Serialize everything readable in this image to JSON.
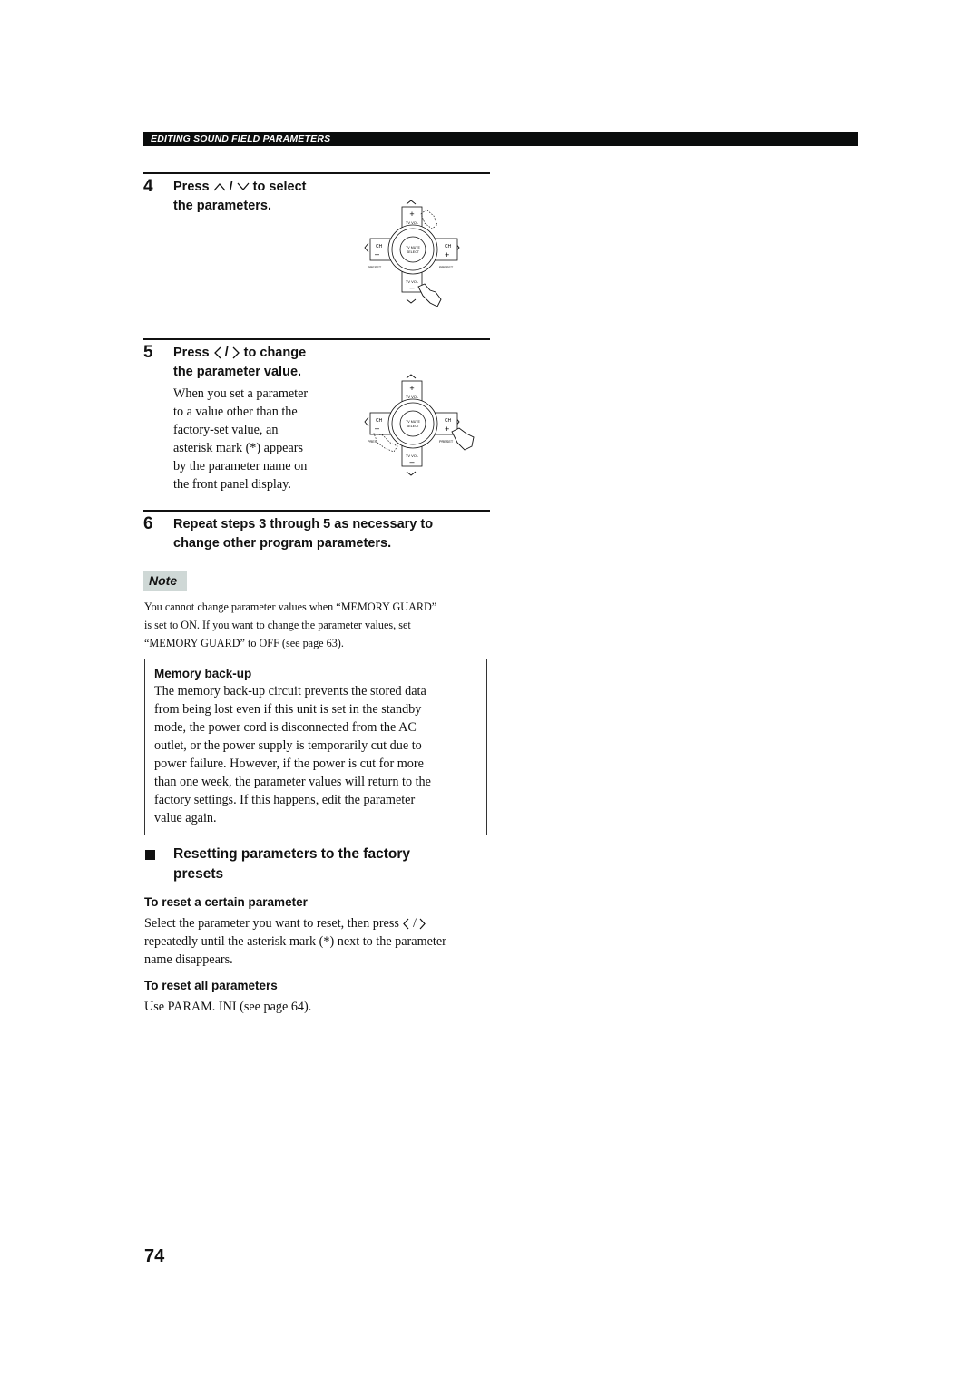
{
  "header": {
    "section_title": "EDITING SOUND FIELD PARAMETERS"
  },
  "steps": [
    {
      "number": "4",
      "title_pre": "Press",
      "title_mid": "/",
      "title_post": "to select",
      "title_line2": "the parameters.",
      "icons": [
        "up-chevron-icon",
        "down-chevron-icon"
      ],
      "remote": {
        "labels": {
          "top": "+",
          "top_sub": "TV VOL",
          "center1": "TV MUTE",
          "center2": "SELECT",
          "left": "CH",
          "left_sub": "–",
          "right": "CH",
          "right_sub": "+",
          "preset_left": "PRESET",
          "preset_right": "PRESET",
          "bottom_sub": "TV VOL",
          "bottom": "–"
        },
        "pressed": "down"
      }
    },
    {
      "number": "5",
      "title_pre": "Press",
      "title_mid": "/",
      "title_post": "to change",
      "title_line2": "the parameter value.",
      "icons": [
        "left-chevron-icon",
        "right-chevron-icon"
      ],
      "body": [
        "When you set a parameter",
        "to a value other than the",
        "factory-set value, an",
        "asterisk mark (*) appears",
        "by the parameter name on",
        "the front panel display."
      ],
      "remote": {
        "labels": {
          "top": "+",
          "top_sub": "TV VOL",
          "center1": "TV MUTE",
          "center2": "SELECT",
          "left": "CH",
          "left_sub": "–",
          "right": "CH",
          "right_sub": "+",
          "preset_left": "PRES",
          "preset_right": "PRESET",
          "bottom_sub": "TV VOL",
          "bottom": "–"
        },
        "pressed": "right"
      }
    },
    {
      "number": "6",
      "title_line1": "Repeat steps 3 through 5 as necessary to",
      "title_line2": "change other program parameters."
    }
  ],
  "note": {
    "label": "Note",
    "lines": [
      "You cannot change parameter values when “MEMORY GUARD”",
      "is set to ON. If you want to change the parameter values, set",
      "“MEMORY GUARD” to OFF (see page 63)."
    ]
  },
  "memory_box": {
    "title": "Memory back-up",
    "lines": [
      "The memory back-up circuit prevents the stored data",
      "from being lost even if this unit is set in the standby",
      "mode, the power cord is disconnected from the AC",
      "outlet, or the power supply is temporarily cut due to",
      "power failure. However, if the power is cut for more",
      "than one week, the parameter values will return to the",
      "factory settings. If this happens, edit the parameter",
      "value again."
    ]
  },
  "reset_section": {
    "title_line1": "Resetting parameters to the factory",
    "title_line2": "presets",
    "certain": {
      "title": "To reset a certain parameter",
      "line1": "Select the parameter you want to reset, then press",
      "line1_slash": "/",
      "line2": "repeatedly until the asterisk mark (*) next to the parameter",
      "line3": "name disappears."
    },
    "all": {
      "title": "To reset all parameters",
      "line1": "Use PARAM. INI (see page 64)."
    }
  },
  "page_number": "74"
}
